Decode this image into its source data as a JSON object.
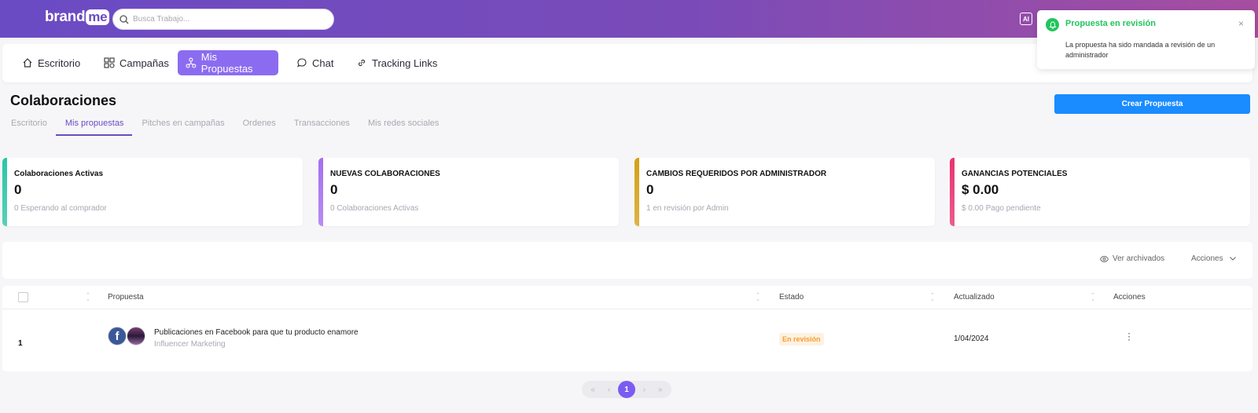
{
  "brand": {
    "name": "brand",
    "suffix": "me"
  },
  "search": {
    "placeholder": "Busca Trabajo..."
  },
  "header": {
    "ai_label": "AI"
  },
  "nav": [
    {
      "label": "Escritorio",
      "icon": "home-icon"
    },
    {
      "label": "Campañas",
      "icon": "campaigns-icon"
    },
    {
      "label": "Mis Propuestas",
      "icon": "proposals-icon",
      "active": true
    },
    {
      "label": "Chat",
      "icon": "chat-icon"
    },
    {
      "label": "Tracking Links",
      "icon": "link-icon"
    }
  ],
  "page": {
    "title": "Colaboraciones",
    "create_button": "Crear Propuesta",
    "tabs": [
      "Escritorio",
      "Mis propuestas",
      "Pitches en campañas",
      "Ordenes",
      "Transacciones",
      "Mis redes sociales"
    ]
  },
  "stats": [
    {
      "label": "Colaboraciones Activas",
      "value": "0",
      "sub": "0 Esperando al comprador",
      "color": "#2ec4a6"
    },
    {
      "label": "NUEVAS COLABORACIONES",
      "value": "0",
      "sub": "0 Colaboraciones Activas",
      "color": "#a66ef0"
    },
    {
      "label": "CAMBIOS REQUERIDOS POR ADMINISTRADOR",
      "value": "0",
      "sub": "1 en revisión por Admin",
      "color": "#d4a017"
    },
    {
      "label": "GANANCIAS POTENCIALES",
      "value": "$ 0.00",
      "sub": "$ 0.00 Pago pendiente",
      "color": "#e8336f"
    }
  ],
  "filters": {
    "archived": "Ver archivados",
    "actions": "Acciones"
  },
  "table": {
    "columns": [
      "Propuesta",
      "Estado",
      "Actualizado",
      "Acciones"
    ],
    "rows": [
      {
        "num": "1",
        "title": "Publicaciones en Facebook para que tu producto enamore",
        "subtitle": "Influencer Marketing",
        "status": "En revisión",
        "updated": "1/04/2024"
      }
    ]
  },
  "pagination": {
    "first": "«",
    "prev": "‹",
    "current": "1",
    "next": "›",
    "last": "»"
  },
  "toast": {
    "title": "Propuesta en revisión",
    "message": "La propuesta ha sido mandada a revisión de un administrador",
    "close": "×"
  }
}
